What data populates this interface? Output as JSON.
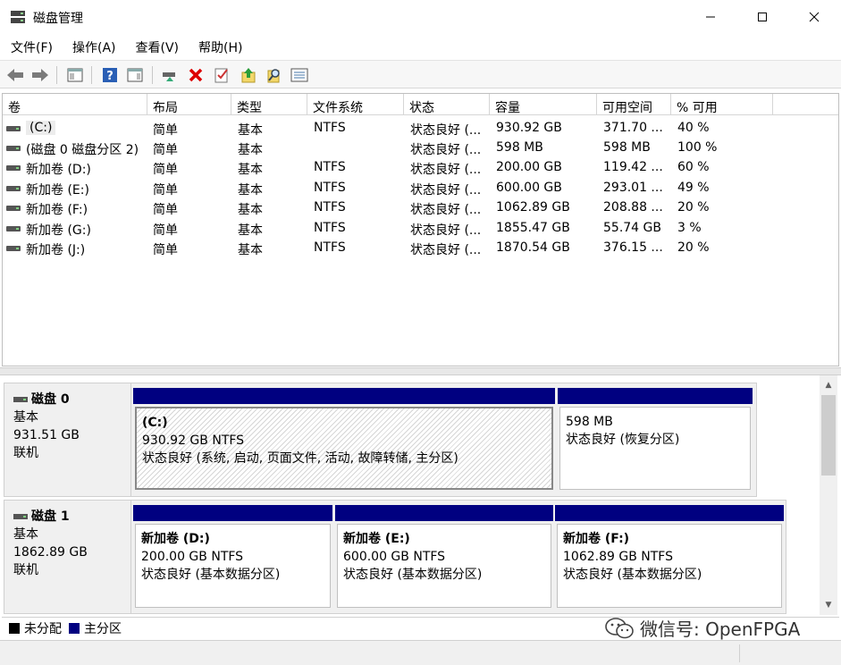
{
  "window": {
    "title": "磁盘管理"
  },
  "menu": [
    "文件(F)",
    "操作(A)",
    "查看(V)",
    "帮助(H)"
  ],
  "toolbar": {
    "icons": [
      "back-icon",
      "forward-icon",
      "console-tree-icon",
      "help-icon",
      "properties-pane-icon",
      "connect-disk-icon",
      "delete-icon",
      "check-icon",
      "import-icon",
      "search-icon",
      "list-view-icon"
    ]
  },
  "table": {
    "headers": [
      "卷",
      "布局",
      "类型",
      "文件系统",
      "状态",
      "容量",
      "可用空间",
      "% 可用"
    ],
    "rows": [
      [
        "(C:)",
        "简单",
        "基本",
        "NTFS",
        "状态良好 (...",
        "930.92 GB",
        "371.70 ...",
        "40 %"
      ],
      [
        "(磁盘 0 磁盘分区 2)",
        "简单",
        "基本",
        "",
        "状态良好 (...",
        "598 MB",
        "598 MB",
        "100 %"
      ],
      [
        "新加卷 (D:)",
        "简单",
        "基本",
        "NTFS",
        "状态良好 (...",
        "200.00 GB",
        "119.42 ...",
        "60 %"
      ],
      [
        "新加卷 (E:)",
        "简单",
        "基本",
        "NTFS",
        "状态良好 (...",
        "600.00 GB",
        "293.01 ...",
        "49 %"
      ],
      [
        "新加卷 (F:)",
        "简单",
        "基本",
        "NTFS",
        "状态良好 (...",
        "1062.89 GB",
        "208.88 ...",
        "20 %"
      ],
      [
        "新加卷 (G:)",
        "简单",
        "基本",
        "NTFS",
        "状态良好 (...",
        "1855.47 GB",
        "55.74 GB",
        "3 %"
      ],
      [
        "新加卷 (J:)",
        "简单",
        "基本",
        "NTFS",
        "状态良好 (...",
        "1870.54 GB",
        "376.15 ...",
        "20 %"
      ]
    ]
  },
  "disks": [
    {
      "name": "磁盘 0",
      "type": "基本",
      "size": "931.51 GB",
      "status": "联机",
      "partitions": [
        {
          "title": "(C:)",
          "size": "930.92 GB NTFS",
          "status": "状态良好 (系统, 启动, 页面文件, 活动, 故障转储, 主分区)"
        },
        {
          "title": "",
          "size": "598 MB",
          "status": "状态良好 (恢复分区)"
        }
      ]
    },
    {
      "name": "磁盘 1",
      "type": "基本",
      "size": "1862.89 GB",
      "status": "联机",
      "partitions": [
        {
          "title": "新加卷  (D:)",
          "size": "200.00 GB NTFS",
          "status": "状态良好 (基本数据分区)"
        },
        {
          "title": "新加卷  (E:)",
          "size": "600.00 GB NTFS",
          "status": "状态良好 (基本数据分区)"
        },
        {
          "title": "新加卷  (F:)",
          "size": "1062.89 GB NTFS",
          "status": "状态良好 (基本数据分区)"
        }
      ]
    }
  ],
  "legend": [
    {
      "label": "未分配",
      "color": "#000000"
    },
    {
      "label": "主分区",
      "color": "#000080"
    }
  ],
  "watermark": "微信号: OpenFPGA",
  "colors": {
    "partition_header": "#000080"
  }
}
